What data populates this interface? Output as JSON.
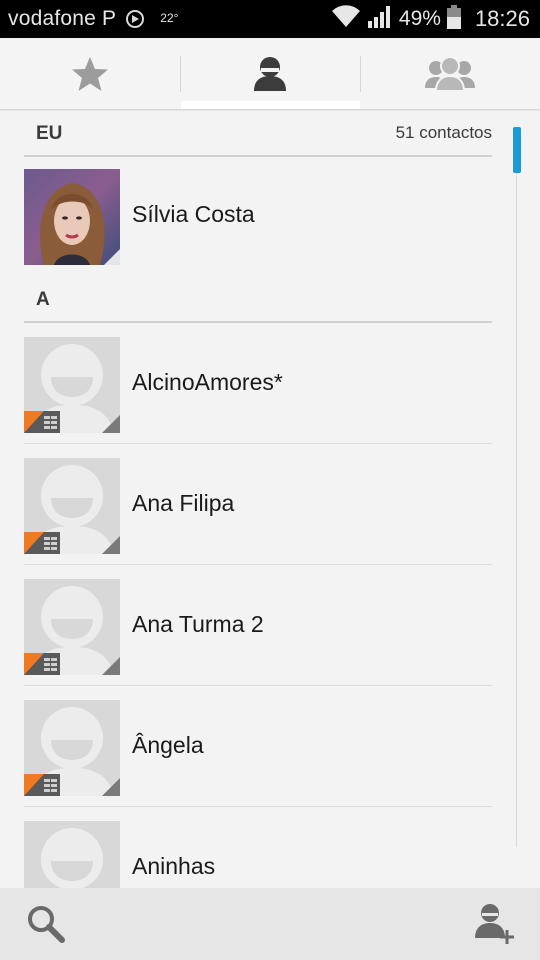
{
  "status_bar": {
    "carrier": "vodafone P",
    "temperature": "22°",
    "battery_percent": "49%",
    "time": "18:26",
    "icons": [
      "sync-icon",
      "wifi-icon",
      "signal-icon",
      "battery-icon"
    ]
  },
  "tabs": [
    {
      "name": "favorites",
      "icon": "star-icon",
      "selected": false
    },
    {
      "name": "contacts",
      "icon": "person-icon",
      "selected": true
    },
    {
      "name": "groups",
      "icon": "group-icon",
      "selected": false
    }
  ],
  "sections": {
    "me": {
      "title": "EU",
      "count": "51 contactos"
    },
    "a": {
      "title": "A"
    }
  },
  "me_contact": {
    "name": "Sílvia Costa",
    "photo": "profile-photo"
  },
  "contacts": [
    {
      "name": "AlcinoAmores*",
      "photo": "default-avatar",
      "sim": true
    },
    {
      "name": "Ana Filipa",
      "photo": "default-avatar",
      "sim": true
    },
    {
      "name": "Ana Turma 2",
      "photo": "default-avatar",
      "sim": true
    },
    {
      "name": "Ângela",
      "photo": "default-avatar",
      "sim": true
    },
    {
      "name": "Aninhas",
      "photo": "default-avatar",
      "sim": false
    }
  ],
  "bottom_bar": {
    "icons": [
      "search-icon",
      "add-contact-icon"
    ]
  },
  "colors": {
    "accent": "#1a9bd7",
    "sim_badge": "#f07a22",
    "status_bar": "#000000",
    "background": "#f3f3f3"
  }
}
